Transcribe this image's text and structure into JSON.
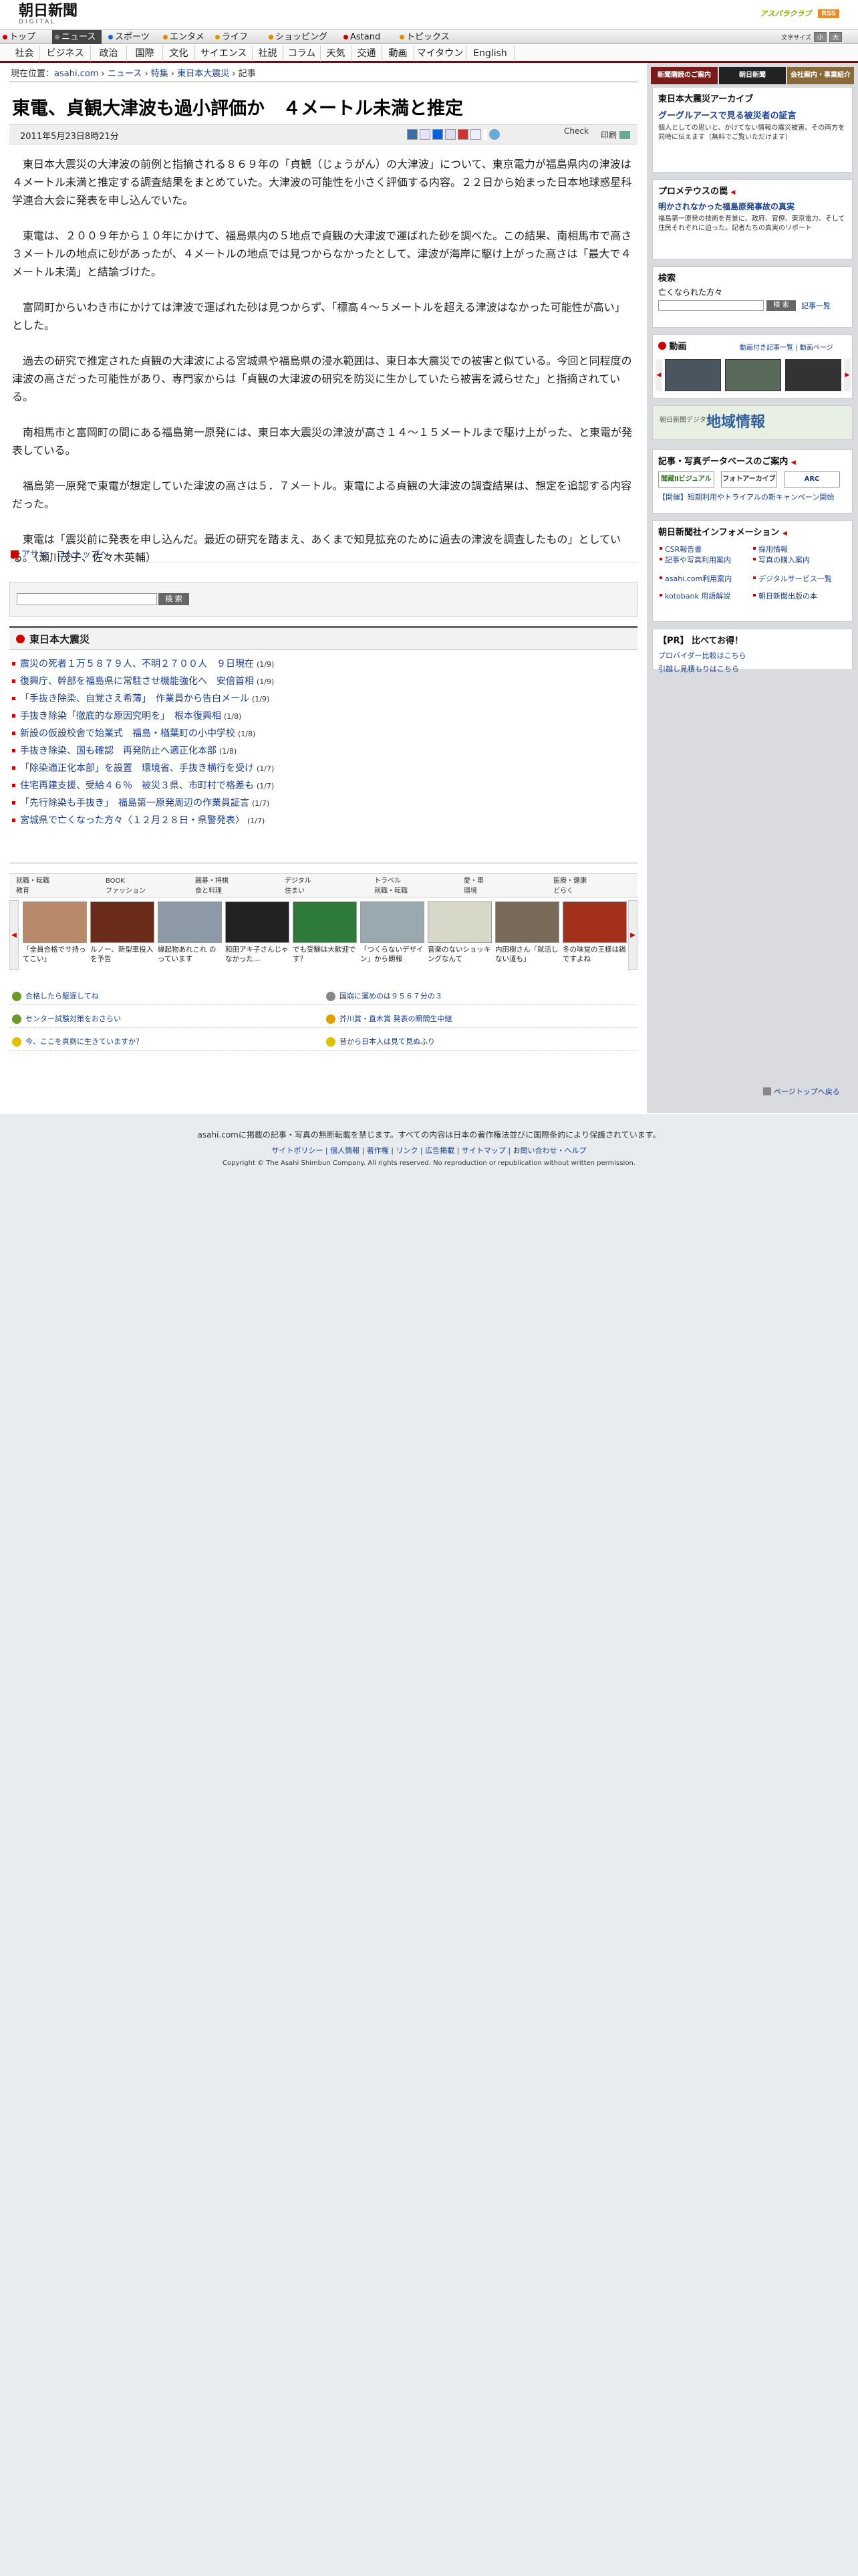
{
  "header": {
    "logo_main": "朝日新聞",
    "logo_sub": "DIGITAL",
    "shopping": "アスパラクラブ",
    "rss": "RSS",
    "font_size_label": "文字サイズ",
    "font_small": "小",
    "font_large": "大"
  },
  "global_nav": [
    {
      "label": "トップ",
      "color": "#c00"
    },
    {
      "label": "ニュース",
      "color": "#888",
      "current": true
    },
    {
      "label": "スポーツ",
      "color": "#1a64c8"
    },
    {
      "label": "エンタメ",
      "color": "#e08a00"
    },
    {
      "label": "ライフ",
      "color": "#d0a000"
    },
    {
      "label": "ショッピング",
      "color": "#e08a00"
    },
    {
      "label": "Astand",
      "color": "#c00"
    },
    {
      "label": "トピックス",
      "color": "#e08a00"
    }
  ],
  "sub_nav": [
    "社会",
    "ビジネス",
    "政治",
    "国際",
    "文化",
    "サイエンス",
    "社説",
    "コラム",
    "天気",
    "交通",
    "動画",
    "マイタウン",
    "English"
  ],
  "breadcrumb": {
    "prefix": "現在位置：",
    "items": [
      "asahi.com",
      "ニュース",
      "特集",
      "東日本大震災",
      "記事"
    ]
  },
  "article": {
    "title": "東電、貞観大津波も過小評価か　４メートル未満と推定",
    "date": "2011年5月23日8時21分",
    "check": "Check",
    "print": "印刷",
    "paragraphs": [
      "東日本大震災の大津波の前例と指摘される８６９年の「貞観（じょうがん）の大津波」について、東京電力が福島県内の津波は４メートル未満と推定する調査結果をまとめていた。大津波の可能性を小さく評価する内容。２２日から始まった日本地球惑星科学連合大会に発表を申し込んでいた。",
      "東電は、２００９年から１０年にかけて、福島県内の５地点で貞観の大津波で運ばれた砂を調べた。この結果、南相馬市で高さ３メートルの地点に砂があったが、４メートルの地点では見つからなかったとして、津波が海岸に駆け上がった高さは「最大で４メートル未満」と結論づけた。",
      "富岡町からいわき市にかけては津波で運ばれた砂は見つからず、「標高４〜５メートルを超える津波はなかった可能性が高い」とした。",
      "過去の研究で推定された貞観の大津波による宮城県や福島県の浸水範囲は、東日本大震災での被害と似ている。今回と同程度の津波の高さだった可能性があり、専門家からは「貞観の大津波の研究を防災に生かしていたら被害を減らせた」と指摘されている。",
      "南相馬市と富岡町の間にある福島第一原発には、東日本大震災の津波が高さ１４〜１５メートルまで駆け上がった、と東電が発表している。",
      "福島第一原発で東電が想定していた津波の高さは５．７メートル。東電による貞観の大津波の調査結果は、想定を追認する内容だった。",
      "東電は「震災前に発表を申し込んだ。最近の研究を踏まえ、あくまで知見拡充のために過去の津波を調査したもの」としている。（瀬川茂子、佐々木英輔）"
    ]
  },
  "toplink": "アサヒ・コムトップへ",
  "search": {
    "button": "検 索"
  },
  "related": {
    "title": "東日本大震災",
    "items": [
      {
        "text": "震災の死者１万５８７９人、不明２７００人　９日現在",
        "date": "(1/9)"
      },
      {
        "text": "復興庁、幹部を福島県に常駐させ機能強化へ　安倍首相",
        "date": "(1/9)"
      },
      {
        "text": "「手抜き除染、自覚さえ希薄」　作業員から告白メール",
        "date": "(1/9)"
      },
      {
        "text": "手抜き除染「徹底的な原因究明を」　根本復興相",
        "date": "(1/8)"
      },
      {
        "text": "新設の仮設校舎で始業式　福島・楢葉町の小中学校",
        "date": "(1/8)"
      },
      {
        "text": "手抜き除染、国も確認　再発防止へ適正化本部",
        "date": "(1/8)"
      },
      {
        "text": "「除染適正化本部」を設置　環境省、手抜き横行を受け",
        "date": "(1/7)"
      },
      {
        "text": "住宅再建支援、受給４６％　被災３県、市町村で格差も",
        "date": "(1/7)"
      },
      {
        "text": "「先行除染も手抜き」　福島第一原発周辺の作業員証言",
        "date": "(1/7)"
      },
      {
        "text": "宮城県で亡くなった方々〈１２月２８日・県警発表〉",
        "date": "(1/7)"
      }
    ]
  },
  "categories": [
    [
      "就職・転職",
      "教育"
    ],
    [
      "BOOK",
      "ファッション"
    ],
    [
      "囲碁・将棋",
      "食と料理"
    ],
    [
      "デジタル",
      "住まい"
    ],
    [
      "トラベル",
      "就職・転職"
    ],
    [
      "愛・車",
      "環境"
    ],
    [
      "医療・健康",
      "どらく"
    ]
  ],
  "thumbs": [
    {
      "cap": "「全員合格でサ持ってこい」",
      "color": "#b98a6a"
    },
    {
      "cap": "ルノー、新型車投入を予告",
      "color": "#6a2b1a"
    },
    {
      "cap": "縁起物あれこれ のっています",
      "color": "#8d99a6"
    },
    {
      "cap": "和田アキ子さんじゃなかった…",
      "color": "#222"
    },
    {
      "cap": "でも受験は大歓迎です？",
      "color": "#2d7a3a"
    },
    {
      "cap": "「つくらないデザイン」から朗報",
      "color": "#9aa9b0"
    },
    {
      "cap": "音楽のないショッキングなんて",
      "color": "#d8d8c8"
    },
    {
      "cap": "内田樹さん「就活しない道も」",
      "color": "#7a6a5a"
    },
    {
      "cap": "冬の味覚の王様は鍋ですよね",
      "color": "#a2301a"
    }
  ],
  "bottom_links": [
    {
      "text": "合格したら駆逐してね",
      "color": "#6a9a2a"
    },
    {
      "text": "国崩に運めのは９５６７分の３",
      "color": "#888"
    },
    {
      "text": "センター試験対策をおさらい",
      "color": "#6a9a2a"
    },
    {
      "text": "芥川賞・直木賞 発表の瞬間生中継",
      "color": "#e0a000"
    },
    {
      "text": "今、ここを真剣に生きていますか？",
      "color": "#e0c000"
    },
    {
      "text": "昔から日本人は見て見ぬふり",
      "color": "#e0c000"
    }
  ],
  "right": {
    "tabs": [
      {
        "label": "新聞購読のご案内",
        "color": "#7a1a1a"
      },
      {
        "label": "朝日新聞",
        "color": "#222"
      },
      {
        "label": "会社案内・事業紹介",
        "color": "#8a6a3a"
      }
    ],
    "archive": {
      "title": "東日本大震災アーカイブ",
      "link": "グーグルアースで見る被災者の証言",
      "text": "個人としての思いと、かけてない情報の震災被害。その両方を同時に伝えます（無料でご覧いただけます）"
    },
    "prometheus": {
      "title": "プロメテウスの罠",
      "link": "明かされなかった福島原発事故の真実",
      "text": "福島第一原発の技術を背景に、政府、官僚、東京電力、そして住民それぞれに迫った。記者たちの真実のリポート"
    },
    "search": {
      "title": "検索",
      "sub": "亡くなられた方々",
      "button": "検 索",
      "link": "記事一覧"
    },
    "video": {
      "title": "動画",
      "links": "動画付き記事一覧 | 動画ページ"
    },
    "chiiki": {
      "t": "朝日新聞デジタル",
      "b": "地域情報"
    },
    "photo": {
      "title": "記事・写真データベースのご案内",
      "logos": [
        "聞蔵Ⅱビジュアル",
        "フォトアーカイブ",
        "ARC"
      ],
      "text": "【開催】短期利用やトライアルの新キャンペーン開始"
    },
    "info": {
      "title": "朝日新聞社インフォメーション",
      "items": [
        "CSR報告書",
        "採用情報",
        "記事や写真利用案内",
        "写真の購入案内",
        "asahi.com利用案内",
        "デジタルサービス一覧",
        "kotobank 用語解説",
        "朝日新聞出版の本"
      ]
    },
    "pr": {
      "title": "【PR】 比べてお得！",
      "links": [
        "プロバイダー比較はこちら",
        "引越し見積もりはこちら"
      ]
    },
    "pagetop": "ページトップへ戻る"
  },
  "footer": {
    "line1": "asahi.comに掲載の記事・写真の無断転載を禁じます。すべての内容は日本の著作権法並びに国際条約により保護されています。",
    "line2": "サイトポリシー | 個人情報 | 著作権 | リンク | 広告掲載 | サイトマップ | お問い合わせ・ヘルプ",
    "line3": "Copyright © The Asahi Shimbun Company. All rights reserved. No reproduction or republication without written permission."
  }
}
